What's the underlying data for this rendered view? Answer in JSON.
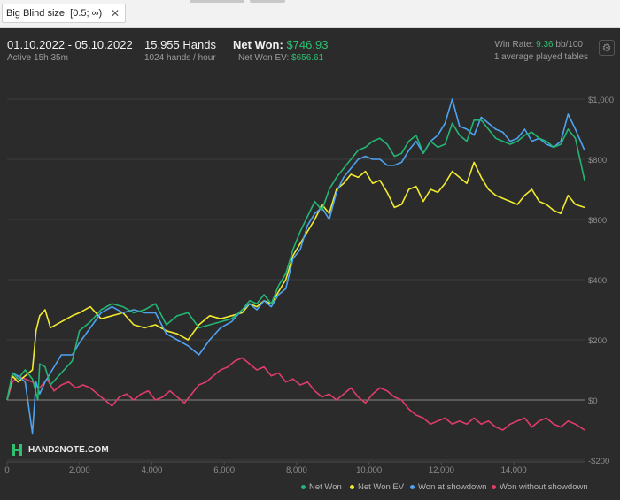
{
  "filter": {
    "chip_label": "Big Blind size: [0.5; ∞)",
    "close_glyph": "✕"
  },
  "header": {
    "date_range": "01.10.2022 - 05.10.2022",
    "active": "Active 15h 35m",
    "hands": "15,955 Hands",
    "hands_rate": "1024 hands / hour",
    "net_won_label": "Net Won:",
    "net_won_value": "$746.93",
    "net_won_ev_label": "Net Won  EV:",
    "net_won_ev_value": "$656.61",
    "win_rate_label": "Win Rate:",
    "win_rate_value": "9.36",
    "win_rate_unit": "bb/100",
    "tables": "1 average played tables",
    "settings_icon": "gear-icon"
  },
  "watermark": {
    "text": "HAND2NOTE.COM"
  },
  "chart_data": {
    "type": "line",
    "x_ticks": [
      "0",
      "2,000",
      "4,000",
      "6,000",
      "8,000",
      "10,000",
      "12,000",
      "14,000"
    ],
    "y_ticks": [
      "$1,000",
      "$800",
      "$600",
      "$400",
      "$200",
      "$0",
      "-$200"
    ],
    "xlim": [
      0,
      15955
    ],
    "ylim": [
      -200,
      1050
    ],
    "grid": true,
    "legend_position": "bottom-right",
    "series": [
      {
        "name": "Net Won",
        "color": "#22b573",
        "x": [
          0,
          150,
          300,
          500,
          700,
          850,
          900,
          1050,
          1200,
          1500,
          1800,
          2000,
          2300,
          2600,
          2900,
          3200,
          3500,
          3800,
          4100,
          4400,
          4700,
          5000,
          5300,
          5600,
          5900,
          6200,
          6500,
          6700,
          6900,
          7100,
          7300,
          7500,
          7700,
          7900,
          8100,
          8300,
          8500,
          8700,
          8900,
          9100,
          9300,
          9500,
          9700,
          9900,
          10100,
          10300,
          10500,
          10700,
          10900,
          11100,
          11300,
          11500,
          11700,
          11900,
          12100,
          12300,
          12500,
          12700,
          12900,
          13100,
          13300,
          13500,
          13700,
          13900,
          14100,
          14300,
          14500,
          14700,
          14900,
          15100,
          15300,
          15500,
          15700,
          15955
        ],
        "y": [
          0,
          90,
          70,
          100,
          70,
          0,
          120,
          110,
          50,
          90,
          130,
          230,
          260,
          300,
          320,
          310,
          290,
          300,
          320,
          250,
          280,
          290,
          240,
          250,
          260,
          270,
          300,
          330,
          320,
          350,
          320,
          380,
          420,
          500,
          560,
          610,
          660,
          630,
          700,
          740,
          770,
          800,
          830,
          840,
          860,
          870,
          850,
          810,
          820,
          860,
          880,
          820,
          860,
          840,
          850,
          920,
          880,
          860,
          930,
          930,
          900,
          870,
          860,
          850,
          860,
          880,
          890,
          870,
          860,
          840,
          850,
          900,
          870,
          730
        ]
      },
      {
        "name": "Net Won  EV",
        "color": "#f0e92d",
        "x": [
          0,
          150,
          300,
          500,
          700,
          800,
          900,
          1050,
          1200,
          1500,
          1800,
          2000,
          2300,
          2600,
          2900,
          3200,
          3500,
          3800,
          4100,
          4400,
          4700,
          5000,
          5300,
          5600,
          5900,
          6200,
          6500,
          6700,
          6900,
          7100,
          7300,
          7500,
          7700,
          7900,
          8100,
          8300,
          8500,
          8700,
          8900,
          9100,
          9300,
          9500,
          9700,
          9900,
          10100,
          10300,
          10500,
          10700,
          10900,
          11100,
          11300,
          11500,
          11700,
          11900,
          12100,
          12300,
          12500,
          12700,
          12900,
          13100,
          13300,
          13500,
          13700,
          13900,
          14100,
          14300,
          14500,
          14700,
          14900,
          15100,
          15300,
          15500,
          15700,
          15955
        ],
        "y": [
          0,
          80,
          60,
          80,
          100,
          230,
          280,
          300,
          240,
          260,
          280,
          290,
          310,
          270,
          280,
          290,
          250,
          240,
          250,
          230,
          220,
          200,
          250,
          280,
          270,
          280,
          290,
          320,
          310,
          330,
          320,
          360,
          400,
          480,
          520,
          560,
          600,
          650,
          620,
          700,
          720,
          750,
          740,
          760,
          720,
          730,
          690,
          640,
          650,
          700,
          710,
          660,
          700,
          690,
          720,
          760,
          740,
          720,
          790,
          740,
          700,
          680,
          670,
          660,
          650,
          680,
          700,
          660,
          650,
          630,
          620,
          680,
          650,
          640
        ]
      },
      {
        "name": "Won at showdown",
        "color": "#4ea2f0",
        "x": [
          0,
          150,
          300,
          500,
          700,
          800,
          900,
          1050,
          1200,
          1500,
          1800,
          2000,
          2300,
          2600,
          2900,
          3200,
          3500,
          3800,
          4100,
          4400,
          4700,
          5000,
          5300,
          5600,
          5900,
          6200,
          6500,
          6700,
          6900,
          7100,
          7300,
          7500,
          7700,
          7900,
          8100,
          8300,
          8500,
          8700,
          8900,
          9100,
          9300,
          9500,
          9700,
          9900,
          10100,
          10300,
          10500,
          10700,
          10900,
          11100,
          11300,
          11500,
          11700,
          11900,
          12100,
          12300,
          12500,
          12700,
          12900,
          13100,
          13300,
          13500,
          13700,
          13900,
          14100,
          14300,
          14500,
          14700,
          14900,
          15100,
          15300,
          15500,
          15700,
          15955
        ],
        "y": [
          0,
          90,
          80,
          60,
          -110,
          60,
          20,
          60,
          90,
          150,
          150,
          190,
          240,
          290,
          310,
          290,
          300,
          290,
          290,
          220,
          200,
          180,
          150,
          200,
          240,
          260,
          300,
          320,
          300,
          330,
          310,
          350,
          370,
          470,
          500,
          580,
          620,
          640,
          600,
          690,
          740,
          770,
          800,
          810,
          800,
          800,
          780,
          780,
          790,
          830,
          860,
          820,
          860,
          880,
          920,
          1000,
          910,
          900,
          880,
          940,
          920,
          900,
          890,
          860,
          870,
          900,
          860,
          870,
          850,
          840,
          860,
          950,
          900,
          830
        ]
      },
      {
        "name": "Won without showdown",
        "color": "#e03c6a",
        "x": [
          0,
          150,
          300,
          500,
          700,
          900,
          1100,
          1300,
          1500,
          1700,
          1900,
          2100,
          2300,
          2500,
          2700,
          2900,
          3100,
          3300,
          3500,
          3700,
          3900,
          4100,
          4300,
          4500,
          4700,
          4900,
          5100,
          5300,
          5500,
          5700,
          5900,
          6100,
          6300,
          6500,
          6700,
          6900,
          7100,
          7300,
          7500,
          7700,
          7900,
          8100,
          8300,
          8500,
          8700,
          8900,
          9100,
          9300,
          9500,
          9700,
          9900,
          10100,
          10300,
          10500,
          10700,
          10900,
          11100,
          11300,
          11500,
          11700,
          11900,
          12100,
          12300,
          12500,
          12700,
          12900,
          13100,
          13300,
          13500,
          13700,
          13900,
          14100,
          14300,
          14500,
          14700,
          14900,
          15100,
          15300,
          15500,
          15700,
          15955
        ],
        "y": [
          0,
          60,
          80,
          70,
          60,
          40,
          70,
          30,
          50,
          60,
          40,
          50,
          40,
          20,
          0,
          -20,
          10,
          20,
          0,
          20,
          30,
          0,
          10,
          30,
          10,
          -10,
          20,
          50,
          60,
          80,
          100,
          110,
          130,
          140,
          120,
          100,
          110,
          80,
          90,
          60,
          70,
          50,
          60,
          30,
          10,
          20,
          0,
          20,
          40,
          10,
          -10,
          20,
          40,
          30,
          10,
          0,
          -30,
          -50,
          -60,
          -80,
          -70,
          -60,
          -80,
          -70,
          -80,
          -60,
          -80,
          -70,
          -90,
          -100,
          -80,
          -70,
          -60,
          -90,
          -70,
          -60,
          -80,
          -90,
          -70,
          -80,
          -100
        ]
      }
    ]
  }
}
